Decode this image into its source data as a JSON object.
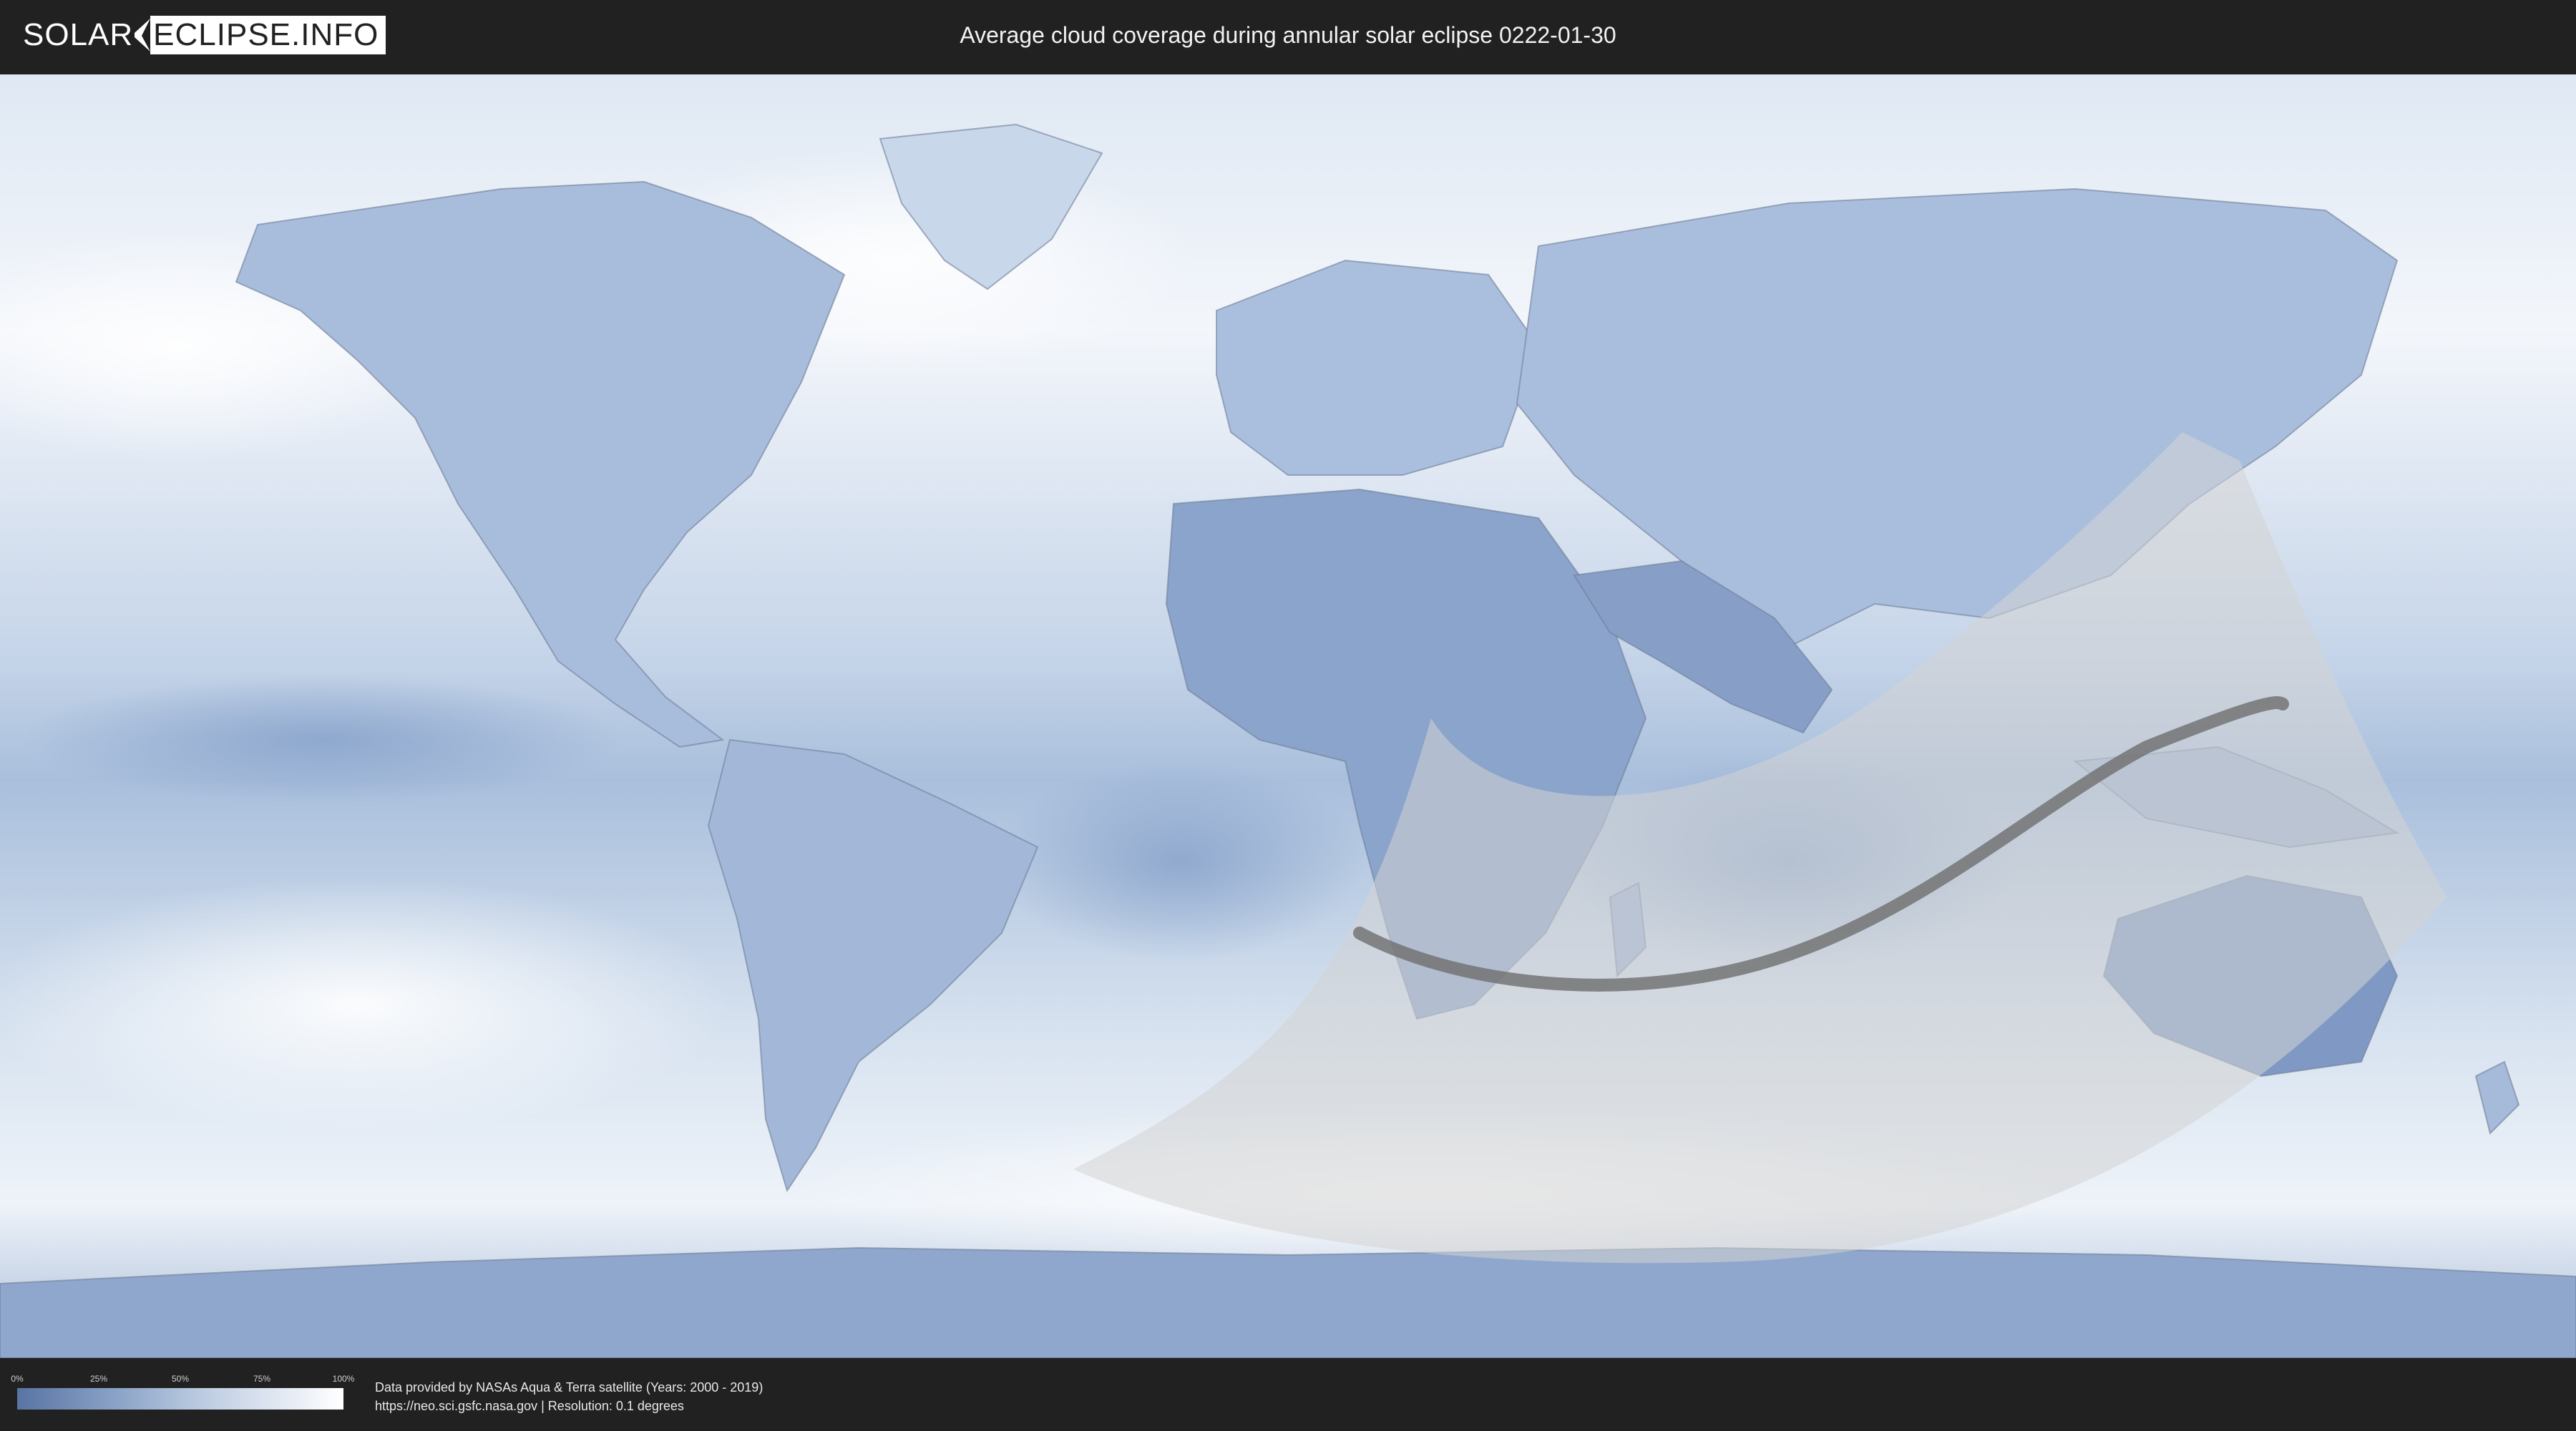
{
  "header": {
    "logo_part1": "SOLAR",
    "logo_part2": "ECLIPSE.INFO",
    "title": "Average cloud coverage during annular solar eclipse 0222-01-30"
  },
  "legend": {
    "ticks": [
      "0%",
      "25%",
      "50%",
      "75%",
      "100%"
    ],
    "colors": {
      "low": "#5874a3",
      "high": "#ffffff"
    }
  },
  "credits": {
    "line1": "Data provided by NASAs Aqua & Terra satellite (Years: 2000 - 2019)",
    "line2": "https://neo.sci.gsfc.nasa.gov | Resolution: 0.1 degrees"
  },
  "map": {
    "ocean_color": "#cfdcec",
    "land_color": "#8ea6cc",
    "eclipse_zone_color": "#d3d3d3",
    "eclipse_path_color": "#6e6e6e"
  }
}
